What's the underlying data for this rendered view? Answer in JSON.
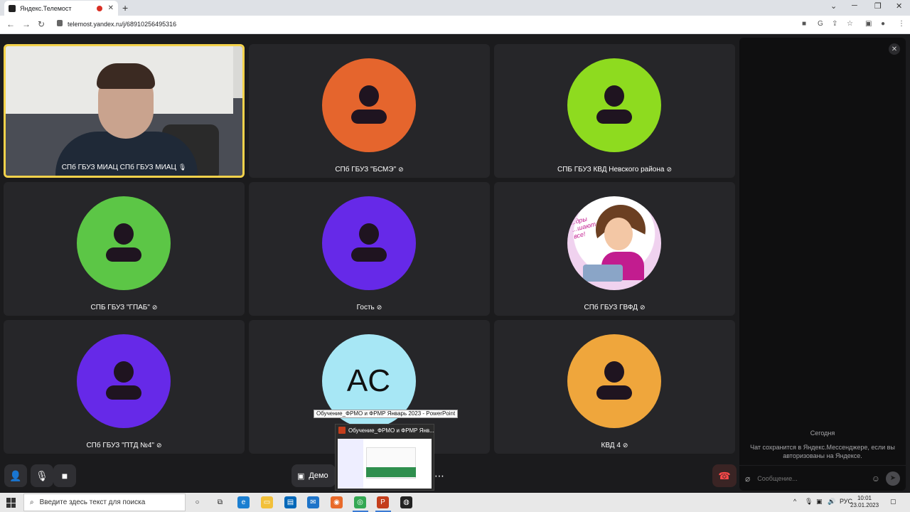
{
  "browser": {
    "tab_title": "Яндекс.Телемост",
    "url": "telemost.yandex.ru/j/68910256495316"
  },
  "tiles": [
    {
      "name": "СПб ГБУЗ МИАЦ СПб ГБУЗ МИАЦ",
      "type": "video"
    },
    {
      "name": "СПб ГБУЗ \"БСМЭ\"",
      "type": "avatar",
      "color": "#e5652d"
    },
    {
      "name": "СПБ ГБУЗ КВД Невского района",
      "type": "avatar",
      "color": "#8edb1f"
    },
    {
      "name": "СПБ ГБУЗ \"ГПАБ\"",
      "type": "avatar",
      "color": "#5cc646"
    },
    {
      "name": "Гость",
      "type": "avatar",
      "color": "#6629e8"
    },
    {
      "name": "СПб ГБУЗ ГВФД",
      "type": "image"
    },
    {
      "name": "СПб ГБУЗ \"ПТД №4\"",
      "type": "avatar",
      "color": "#6629e8"
    },
    {
      "name": "",
      "type": "initials",
      "initials": "АС",
      "color": "#a7e7f5"
    },
    {
      "name": "КВД 4",
      "type": "avatar",
      "color": "#efa63c"
    }
  ],
  "cartoon_text": "...дры ...шают все!",
  "controls": {
    "demo_label": "Демо"
  },
  "chat": {
    "date_label": "Сегодня",
    "info": "Чат сохранится в Яндекс.Мессенджере, если вы авторизованы на Яндексе.",
    "input_placeholder": "Сообщение..."
  },
  "taskbar": {
    "search_placeholder": "Введите здесь текст для поиска",
    "ppt_tooltip": "Обучение_ФРМО и ФРМР Январь 2023 - PowerPoint",
    "preview_title": "Обучение_ФРМО и ФРМР Янв...",
    "lang": "РУС",
    "time": "10:01",
    "date": "23.01.2023"
  }
}
